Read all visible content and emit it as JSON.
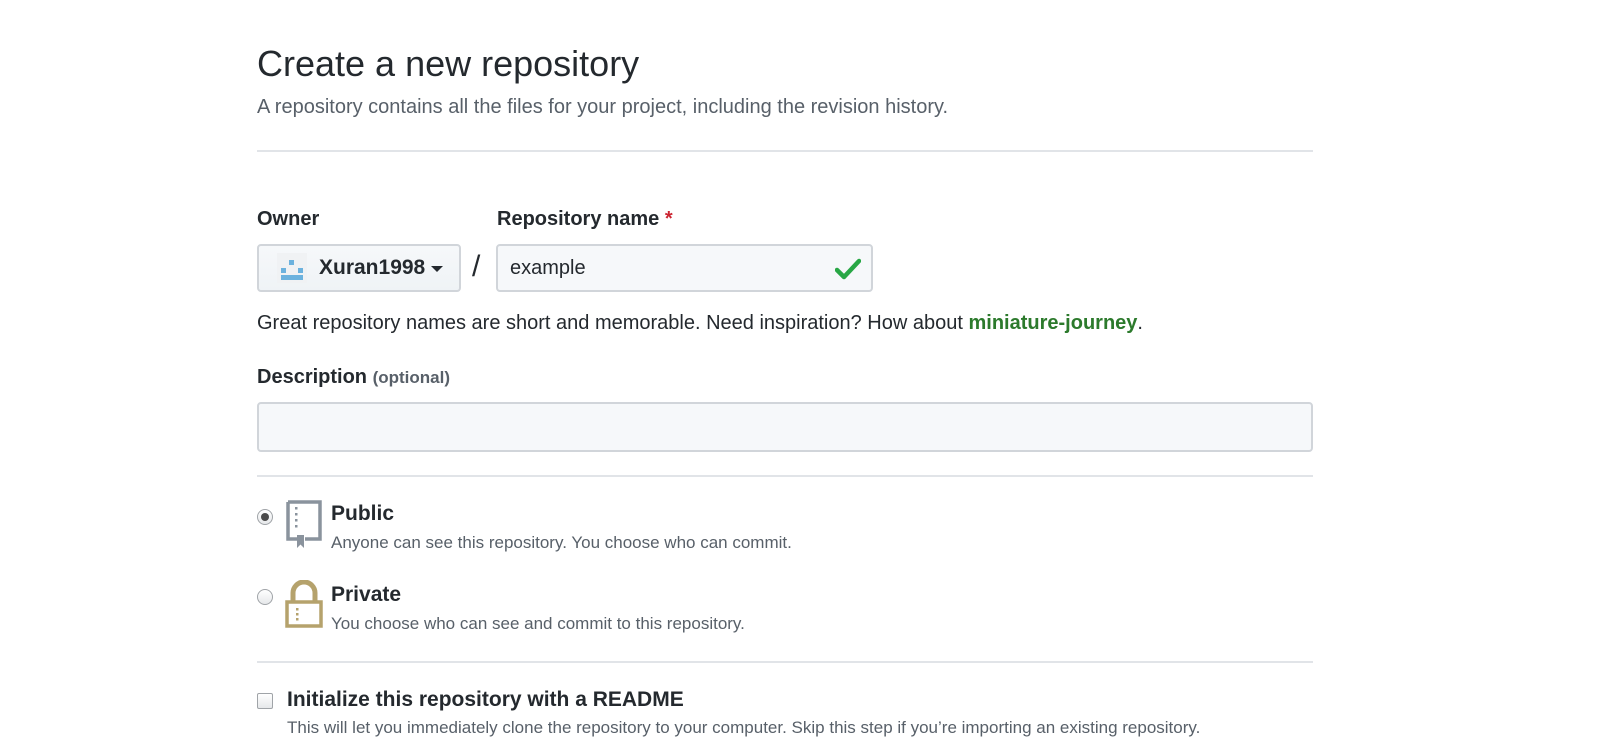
{
  "header": {
    "title": "Create a new repository",
    "subtitle": "A repository contains all the files for your project, including the revision history."
  },
  "owner": {
    "label": "Owner",
    "selected": "Xuran1998",
    "avatar_icon": "identicon-avatar",
    "dropdown_icon": "caret-down-icon"
  },
  "separator": "/",
  "repository_name": {
    "label": "Repository name",
    "required_mark": "*",
    "value": "example",
    "status_icon": "check-icon",
    "valid": true
  },
  "hint": {
    "text": "Great repository names are short and memorable. Need inspiration? How about",
    "suggestion": "miniature-journey",
    "suffix": "."
  },
  "description": {
    "label": "Description",
    "optional_label": "(optional)",
    "value": "",
    "placeholder": ""
  },
  "visibility": {
    "selected": "public",
    "options": [
      {
        "id": "public",
        "title": "Public",
        "description": "Anyone can see this repository. You choose who can commit.",
        "icon": "repo-book-icon",
        "checked": true
      },
      {
        "id": "private",
        "title": "Private",
        "description": "You choose who can see and commit to this repository.",
        "icon": "lock-icon",
        "checked": false
      }
    ]
  },
  "readme": {
    "title": "Initialize this repository with a README",
    "description": "This will let you immediately clone the repository to your computer. Skip this step if you’re importing an existing repository.",
    "checked": false
  },
  "colors": {
    "text_primary": "#24292e",
    "text_secondary": "#586069",
    "required": "#cb2431",
    "success": "#28a745",
    "suggestion": "#2c7a2c",
    "lock_icon": "#b5a26c",
    "repo_icon": "#8a939d",
    "border": "#d1d5da",
    "divider": "#e1e4e8"
  }
}
